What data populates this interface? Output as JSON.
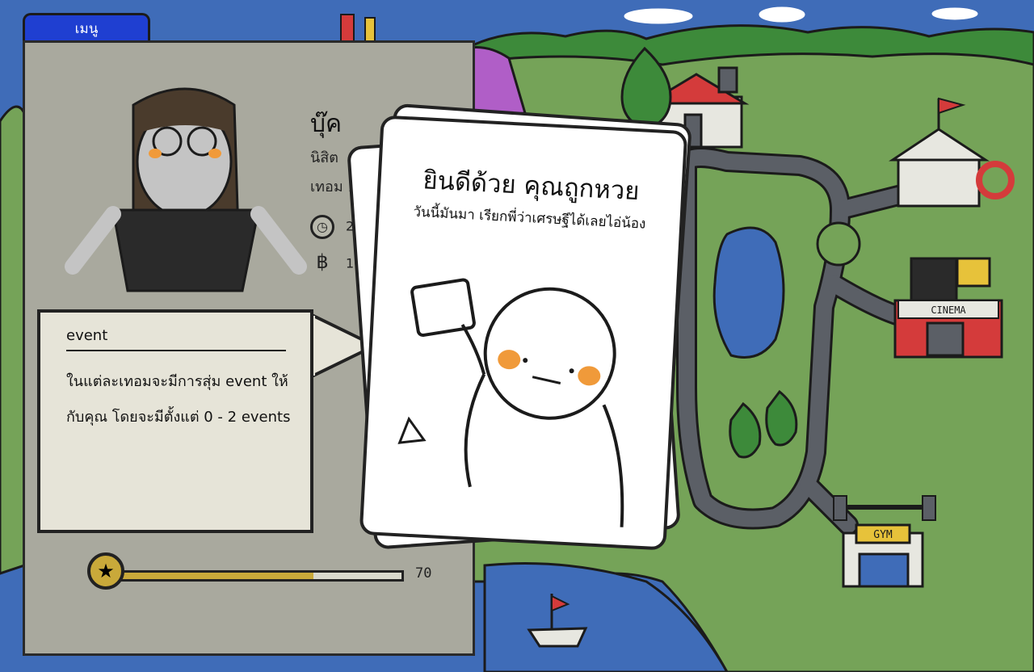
{
  "menu": {
    "tab_label": "เมนู"
  },
  "character": {
    "name": "บุ๊ค",
    "role": "นิสิต",
    "term": "เทอม 1",
    "time_value": "2",
    "money_value": "10"
  },
  "tooltip": {
    "title": "event",
    "body": "ในแต่ละเทอมจะมีการสุ่ม event ให้กับคุณ โดยจะมีตั้งแต่ 0 - 2 events"
  },
  "card": {
    "title": "ยินดีด้วย คุณถูกหวย",
    "subtitle": "วันนี้มันมา เรียกพี่ว่าเศรษฐีได้เลยไอ่น้อง"
  },
  "stats": {
    "bottom_bar_value": "70",
    "bottom_bar_fraction": 0.7
  },
  "map": {
    "cinema_label": "CINEMA",
    "gym_label": "GYM"
  },
  "icons": {
    "time": "clock-icon",
    "money": "baht-icon",
    "star": "star-icon"
  },
  "colors": {
    "sea": "#3f6cb8",
    "grass": "#75a358",
    "menu_tab": "#1f3fd1",
    "panel": "#a9a99e",
    "gauge": "#c9a93a"
  }
}
